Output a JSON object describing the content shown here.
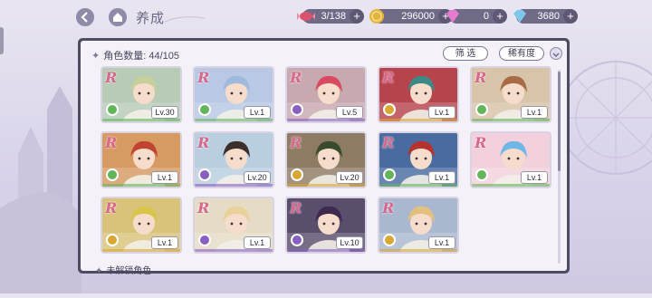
{
  "header": {
    "title": "养成",
    "resources": [
      {
        "name": "stamina",
        "value": "3/138",
        "icon": "candy-icon",
        "color": "#d9536f"
      },
      {
        "name": "gold",
        "value": "296000",
        "icon": "coin-icon",
        "color": "#e3b43b"
      },
      {
        "name": "gem",
        "value": "0",
        "icon": "pink-diamond-icon",
        "color": "#e77ad1"
      },
      {
        "name": "diamond",
        "value": "3680",
        "icon": "blue-diamond-icon",
        "color": "#7fc7ea"
      }
    ]
  },
  "panel": {
    "count_label": "角色数量: 44/105",
    "filter_label": "筛 选",
    "sort_label": "稀有度",
    "locked_label": "未解锁角色"
  },
  "cards": [
    {
      "rank": "R",
      "level": "Lv.30",
      "element": "green",
      "hair": "#c8cf9a",
      "bg": "#b7cbb7"
    },
    {
      "rank": "R",
      "level": "Lv.1",
      "element": "green",
      "hair": "#9fb9dc",
      "bg": "#b8c8e5"
    },
    {
      "rank": "R",
      "level": "Lv.5",
      "element": "purple",
      "hair": "#d84a5f",
      "bg": "#c9a9b0"
    },
    {
      "rank": "R",
      "level": "Lv.1",
      "element": "gold",
      "hair": "#3c8a86",
      "bg": "#b7434d"
    },
    {
      "rank": "R",
      "level": "Lv.1",
      "element": "green",
      "hair": "#a86b45",
      "bg": "#d8c4a8"
    },
    {
      "rank": "R",
      "level": "Lv.1",
      "element": "green",
      "hair": "#c0442f",
      "bg": "#d69a62"
    },
    {
      "rank": "R",
      "level": "Lv.20",
      "element": "purple",
      "hair": "#3b2f2c",
      "bg": "#b9cfe0"
    },
    {
      "rank": "R",
      "level": "Lv.20",
      "element": "gold",
      "hair": "#394b2d",
      "bg": "#8e7b63"
    },
    {
      "rank": "R",
      "level": "Lv.1",
      "element": "green",
      "hair": "#b6322f",
      "bg": "#496ba0"
    },
    {
      "rank": "R",
      "level": "Lv.1",
      "element": "green",
      "hair": "#6fb7e8",
      "bg": "#f2d0dc"
    },
    {
      "rank": "R",
      "level": "Lv.1",
      "element": "gold",
      "hair": "#d9c54a",
      "bg": "#d9c27a"
    },
    {
      "rank": "R",
      "level": "Lv.1",
      "element": "purple",
      "hair": "#e8d19a",
      "bg": "#e6dcc6"
    },
    {
      "rank": "R",
      "level": "Lv.10",
      "element": "purple",
      "hair": "#3e2a4f",
      "bg": "#5a4e6d"
    },
    {
      "rank": "R",
      "level": "Lv.1",
      "element": "gold",
      "hair": "#e3c07e",
      "bg": "#a9b7cf"
    }
  ]
}
